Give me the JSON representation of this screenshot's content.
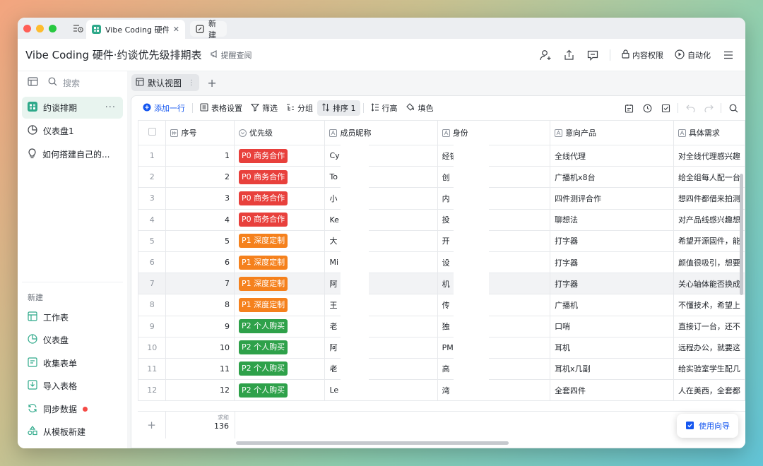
{
  "window": {
    "tabs": [
      {
        "label": "Vibe Coding 硬件·约"
      },
      {
        "label": "新建"
      }
    ]
  },
  "header": {
    "title": "Vibe Coding 硬件·约谈优先级排期表",
    "remind": "提醒查阅",
    "content_permission": "内容权限",
    "automation": "自动化"
  },
  "sidebar": {
    "search_label": "搜索",
    "items": [
      {
        "label": "约谈排期",
        "icon": "table-icon",
        "active": true
      },
      {
        "label": "仪表盘1",
        "icon": "dashboard-icon"
      },
      {
        "label": "如何搭建自己的...",
        "icon": "lightbulb-icon"
      }
    ],
    "new_label": "新建",
    "new_items": [
      {
        "label": "工作表",
        "icon": "sheet-add-icon"
      },
      {
        "label": "仪表盘",
        "icon": "dashboard-add-icon"
      },
      {
        "label": "收集表单",
        "icon": "form-icon"
      },
      {
        "label": "导入表格",
        "icon": "import-icon"
      },
      {
        "label": "同步数据",
        "icon": "sync-icon"
      },
      {
        "label": "从模板新建",
        "icon": "template-icon"
      }
    ]
  },
  "view": {
    "tab_label": "默认视图"
  },
  "toolbar": {
    "add_row": "添加一行",
    "table_settings": "表格设置",
    "filter": "筛选",
    "group": "分组",
    "sort": "排序 1",
    "row_height": "行高",
    "fill": "填色"
  },
  "table": {
    "columns": [
      "序号",
      "优先级",
      "成员昵称",
      "身份",
      "意向产品",
      "具体需求"
    ],
    "rows": [
      {
        "rn": "1",
        "seq": "1",
        "priority": "P0 商务合作",
        "nick": "Cy",
        "identity": "经销",
        "product": "全线代理",
        "need": "对全线代理感兴趣"
      },
      {
        "rn": "2",
        "seq": "2",
        "priority": "P0 商务合作",
        "nick": "To",
        "identity": "创",
        "product": "广播机x8台",
        "need": "给全组每人配一台"
      },
      {
        "rn": "3",
        "seq": "3",
        "priority": "P0 商务合作",
        "nick": "小",
        "identity": "内",
        "product": "四件测评合作",
        "need": "想四件都借来拍测"
      },
      {
        "rn": "4",
        "seq": "4",
        "priority": "P0 商务合作",
        "nick": "Ke",
        "identity": "投",
        "product": "聊想法",
        "need": "对产品线感兴趣想"
      },
      {
        "rn": "5",
        "seq": "5",
        "priority": "P1 深度定制",
        "nick": "大",
        "identity": "开",
        "product": "打字器",
        "need": "希望开源固件，能"
      },
      {
        "rn": "6",
        "seq": "6",
        "priority": "P1 深度定制",
        "nick": "Mi",
        "identity": "设",
        "product": "打字器",
        "need": "颜值很吸引，想要"
      },
      {
        "rn": "7",
        "seq": "7",
        "priority": "P1 深度定制",
        "nick": "阿",
        "identity": "机",
        "product": "打字器",
        "need": "关心轴体能否换成"
      },
      {
        "rn": "8",
        "seq": "8",
        "priority": "P1 深度定制",
        "nick": "王",
        "identity": "传",
        "product": "广播机",
        "need": "不懂技术，希望上"
      },
      {
        "rn": "9",
        "seq": "9",
        "priority": "P2 个人购买",
        "nick": "老",
        "identity": "独",
        "product": "口哨",
        "need": "直接订一台，还不"
      },
      {
        "rn": "10",
        "seq": "10",
        "priority": "P2 个人购买",
        "nick": "阿",
        "identity": "PM",
        "product": "耳机",
        "need": "远程办公，就要这"
      },
      {
        "rn": "11",
        "seq": "11",
        "priority": "P2 个人购买",
        "nick": "老",
        "identity": "高",
        "product": "耳机x几副",
        "need": "给实验室学生配几"
      },
      {
        "rn": "12",
        "seq": "12",
        "priority": "P2 个人购买",
        "nick": "Le",
        "identity": "湾",
        "product": "全套四件",
        "need": "人在美西，全套都"
      }
    ],
    "sum_label": "求和",
    "sum_value": "136"
  },
  "guide_button": "使用向导",
  "colors": {
    "p0": "#e8403c",
    "p1": "#f5811d",
    "p2": "#2ea14a",
    "accent": "#1456f0"
  }
}
